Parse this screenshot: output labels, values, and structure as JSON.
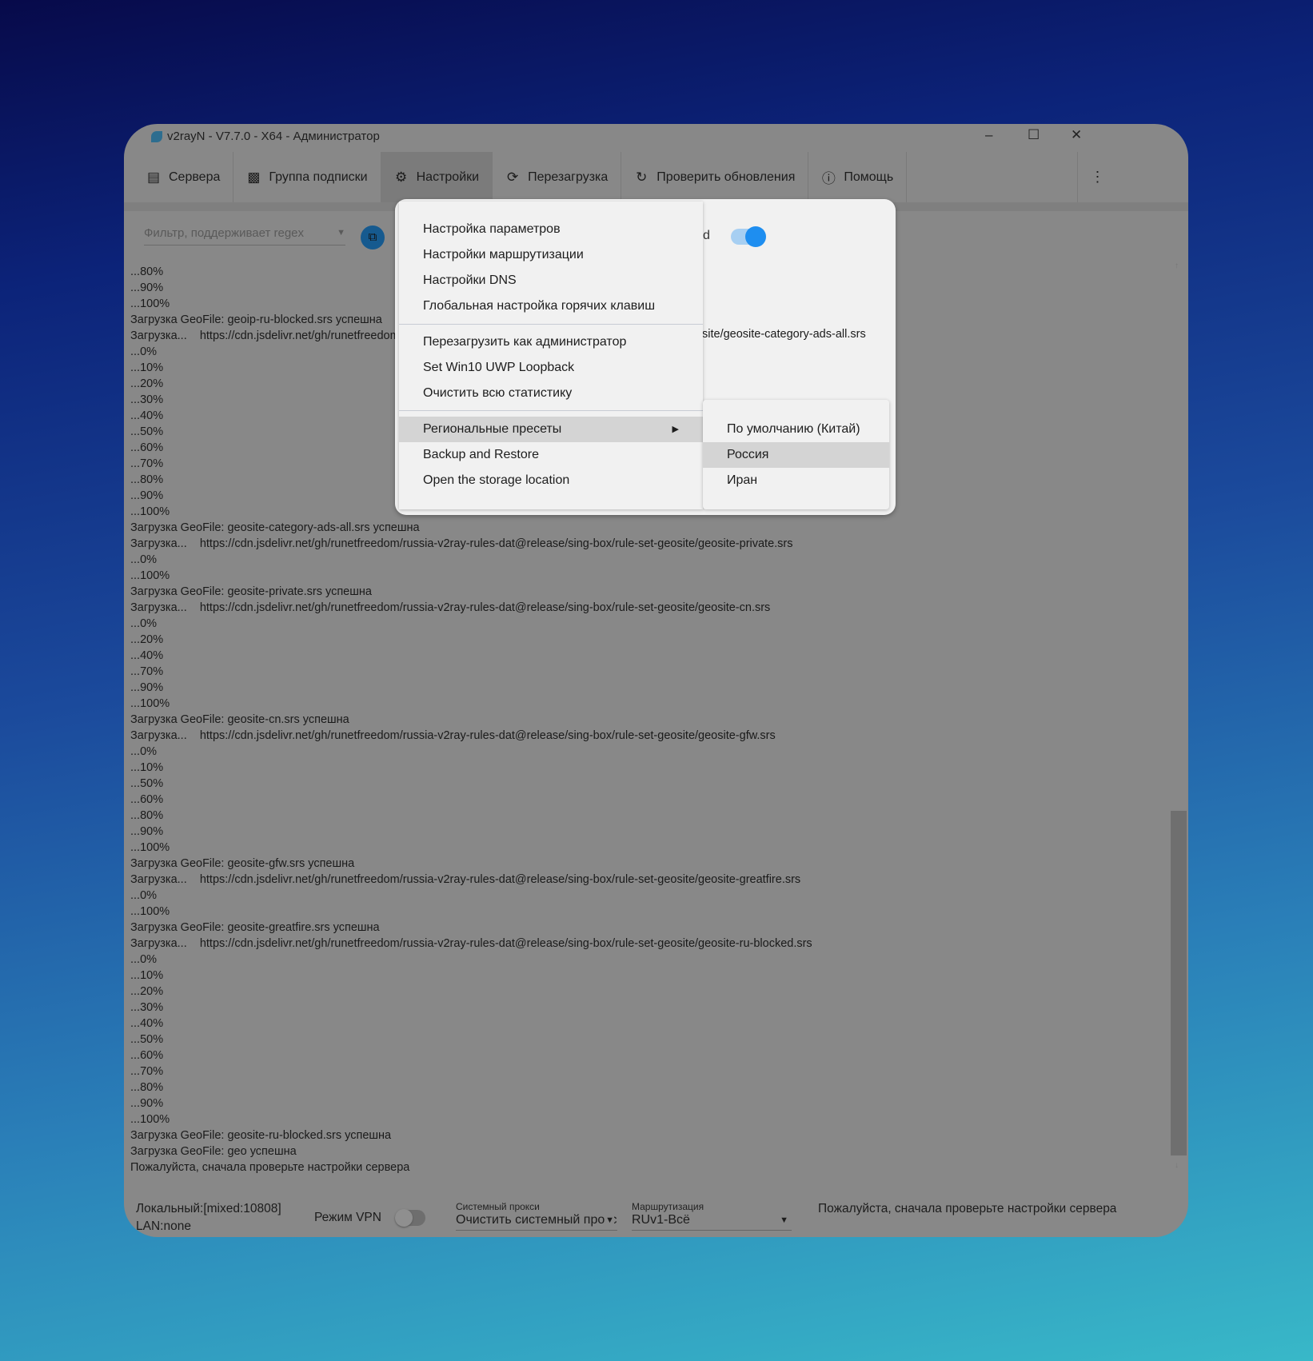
{
  "window": {
    "title": "v2rayN - V7.7.0 - X64 - Администратор"
  },
  "toolbar": [
    {
      "label": "Сервера",
      "icon": "server-icon"
    },
    {
      "label": "Группа подписки",
      "icon": "subscription-icon"
    },
    {
      "label": "Настройки",
      "icon": "gear-icon"
    },
    {
      "label": "Перезагрузка",
      "icon": "reload-icon"
    },
    {
      "label": "Проверить обновления",
      "icon": "update-icon"
    },
    {
      "label": "Помощь",
      "icon": "help-icon"
    }
  ],
  "filter": {
    "placeholder": "Фильтр, поддерживает regex"
  },
  "partial": {
    "toggle_label_fragment": "d",
    "log_fragment": "site/geosite-category-ads-all.srs"
  },
  "log": [
    "...80%",
    "...90%",
    "...100%",
    "Загрузка GeoFile: geoip-ru-blocked.srs успешна",
    "Загрузка...    https://cdn.jsdelivr.net/gh/runetfreedom/russia-v2ray-rules-dat@release/sing-box/rule-set-geosite/geosite-category-ads-all.srs",
    "...0%",
    "...10%",
    "...20%",
    "...30%",
    "...40%",
    "...50%",
    "...60%",
    "...70%",
    "...80%",
    "...90%",
    "...100%",
    "Загрузка GeoFile: geosite-category-ads-all.srs успешна",
    "Загрузка...    https://cdn.jsdelivr.net/gh/runetfreedom/russia-v2ray-rules-dat@release/sing-box/rule-set-geosite/geosite-private.srs",
    "...0%",
    "...100%",
    "Загрузка GeoFile: geosite-private.srs успешна",
    "Загрузка...    https://cdn.jsdelivr.net/gh/runetfreedom/russia-v2ray-rules-dat@release/sing-box/rule-set-geosite/geosite-cn.srs",
    "...0%",
    "...20%",
    "...40%",
    "...70%",
    "...90%",
    "...100%",
    "Загрузка GeoFile: geosite-cn.srs успешна",
    "Загрузка...    https://cdn.jsdelivr.net/gh/runetfreedom/russia-v2ray-rules-dat@release/sing-box/rule-set-geosite/geosite-gfw.srs",
    "...0%",
    "...10%",
    "...50%",
    "...60%",
    "...80%",
    "...90%",
    "...100%",
    "Загрузка GeoFile: geosite-gfw.srs успешна",
    "Загрузка...    https://cdn.jsdelivr.net/gh/runetfreedom/russia-v2ray-rules-dat@release/sing-box/rule-set-geosite/geosite-greatfire.srs",
    "...0%",
    "...100%",
    "Загрузка GeoFile: geosite-greatfire.srs успешна",
    "Загрузка...    https://cdn.jsdelivr.net/gh/runetfreedom/russia-v2ray-rules-dat@release/sing-box/rule-set-geosite/geosite-ru-blocked.srs",
    "...0%",
    "...10%",
    "...20%",
    "...30%",
    "...40%",
    "...50%",
    "...60%",
    "...70%",
    "...80%",
    "...90%",
    "...100%",
    "Загрузка GeoFile: geosite-ru-blocked.srs успешна",
    "Загрузка GeoFile: geo успешна",
    "Пожалуйста, сначала проверьте настройки сервера"
  ],
  "menu": {
    "items": [
      "Настройка параметров",
      "Настройки маршрутизации",
      "Настройки DNS",
      "Глобальная настройка горячих клавиш",
      "Перезагрузить как администратор",
      "Set Win10 UWP Loopback",
      "Очистить всю статистику",
      "Региональные пресеты",
      "Backup and Restore",
      "Open the storage location"
    ],
    "highlighted": "Региональные пресеты",
    "submenu": [
      "По умолчанию (Китай)",
      "Россия",
      "Иран"
    ],
    "submenu_highlighted": "Россия"
  },
  "status": {
    "local": "Локальный:[mixed:10808]",
    "lan": "LAN:none",
    "vpn_label": "Режим VPN",
    "vpn_on": false,
    "proxy_label": "Системный прокси",
    "proxy_value": "Очистить системный прокси",
    "routing_label": "Маршрутизация",
    "routing_value": "RUv1-Всё",
    "message": "Пожалуйста, сначала проверьте настройки сервера"
  }
}
